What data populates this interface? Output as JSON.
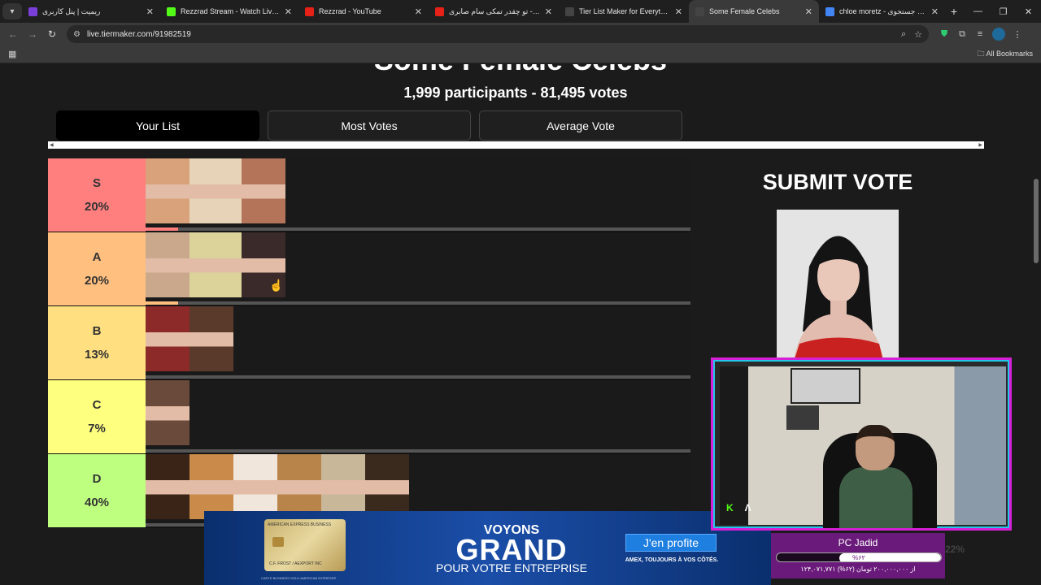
{
  "browser": {
    "tabs": [
      {
        "title": "ریمیت | پنل کاربری",
        "favicon": "#7a3fd9",
        "active": false
      },
      {
        "title": "Rezzrad Stream - Watch Live on",
        "favicon": "#53fc18",
        "active": false
      },
      {
        "title": "Rezzrad - YouTube",
        "favicon": "#e62117",
        "active": false
      },
      {
        "title": "تو چقدر تمکی سام صابری - Tube",
        "favicon": "#e62117",
        "active": false
      },
      {
        "title": "Tier List Maker for Everything -",
        "favicon": "#444444",
        "active": false
      },
      {
        "title": "Some Female Celebs",
        "favicon": "#444444",
        "active": true
      },
      {
        "title": "chloe moretz - جستجوی Google",
        "favicon": "#4285f4",
        "active": false
      }
    ],
    "url": "live.tiermaker.com/91982519",
    "bookmarks_label": "All Bookmarks"
  },
  "page": {
    "title": "Some Female Celebs",
    "stats": "1,999 participants - 81,495 votes",
    "view_buttons": [
      "Your List",
      "Most Votes",
      "Average Vote"
    ],
    "selected_view": "Your List"
  },
  "tiers": [
    {
      "label": "S",
      "percent": "20%",
      "color": "#ff7f7f",
      "bar_fill": 0.06,
      "bar_color": "#ff7f7f",
      "items": [
        "#d9a27a",
        "#e7d4b8",
        "#b3745a"
      ]
    },
    {
      "label": "A",
      "percent": "20%",
      "color": "#ffbf7f",
      "bar_fill": 0.06,
      "bar_color": "#ffbf7f",
      "items": [
        "#c9a88c",
        "#dbd39a",
        "#3a2a2a"
      ]
    },
    {
      "label": "B",
      "percent": "13%",
      "color": "#ffdf7f",
      "bar_fill": 0.0,
      "bar_color": "#ffdf7f",
      "items": [
        "#8c2a2a",
        "#5a3a2a"
      ]
    },
    {
      "label": "C",
      "percent": "7%",
      "color": "#ffff7f",
      "bar_fill": 0.0,
      "bar_color": "#ffff7f",
      "items": [
        "#6a4a3a"
      ]
    },
    {
      "label": "D",
      "percent": "40%",
      "color": "#bfff7f",
      "bar_fill": 0.0,
      "bar_color": "#bfff7f",
      "items": [
        "#3a2418",
        "#c98a4a",
        "#f0e6dc",
        "#b8844a",
        "#c9b79a",
        "#3a2a1e"
      ]
    }
  ],
  "submit": {
    "title": "SUBMIT VOTE",
    "faded_percent": "22%"
  },
  "ad": {
    "card_brand": "AMERICAN EXPRESS BUSINESS",
    "card_holder": "C.F. FROST / AEXPORT INC",
    "card_caption": "CARTE BUSINESS GOLD AMERICAN EXPRESS®",
    "headline_top": "VOYONS",
    "headline_main": "GRAND",
    "headline_bottom": "POUR VOTRE ENTREPRISE",
    "cta": "J'en profite",
    "subline": "AMEX, TOUJOURS À VOS CÔTÉS."
  },
  "stream": {
    "donation_title": "PC Jadid",
    "donation_percent": "%۶۲",
    "donation_progress": 0.62,
    "donation_amount": "۱۲۴,۰۷۱,۷۷۱ از ۲۰۰,۰۰۰,۰۰۰ تومان (۶۲%)"
  }
}
